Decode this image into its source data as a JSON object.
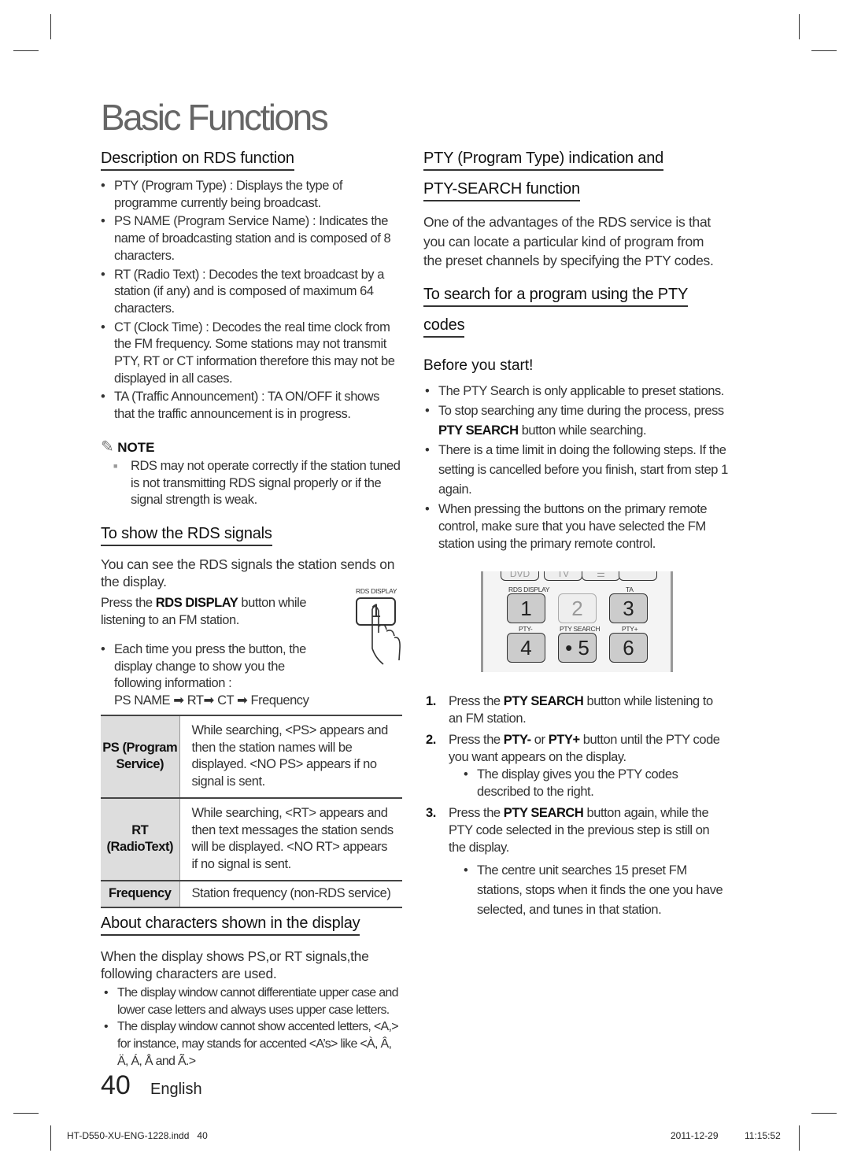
{
  "page": {
    "title": "Basic Functions",
    "page_number": "40",
    "language": "English"
  },
  "left": {
    "desc_heading": "Description on RDS function",
    "desc_items": [
      "PTY (Program Type) : Displays the type of programme currently being broadcast.",
      "PS NAME (Program Service Name) : Indicates the name of broadcasting station and is composed of 8 characters.",
      "RT (Radio Text) : Decodes the text broadcast by a station (if any) and is composed of maximum 64 characters.",
      "CT (Clock Time) : Decodes the real time clock from the FM frequency. Some stations may not transmit PTY, RT or CT information therefore this may not be displayed in all cases.",
      "TA (Traffic Announcement) : TA ON/OFF it shows that the traffic announcement is in progress."
    ],
    "note_label": "NOTE",
    "note_text": "RDS may not operate correctly if the station tuned is not transmitting RDS signal properly or if the signal strength is weak.",
    "show_heading": "To show the RDS signals",
    "show_para": "You can see the RDS signals the station sends on the display.",
    "press_pre": "Press the ",
    "press_bold": "RDS DISPLAY",
    "press_post": " button while listening to an FM station.",
    "illus_label": "RDS DISPLAY",
    "illus_key": "1",
    "each_time": "Each time you press the button, the display change to show you the following information :",
    "sequence": "PS NAME ➡ RT➡ CT ➡ Frequency",
    "table": [
      {
        "key": "PS (Program Service)",
        "value": "While searching, <PS> appears and then the station names will be displayed. <NO PS> appears if no signal is sent."
      },
      {
        "key": "RT (RadioText)",
        "value": "While searching, <RT> appears and then text messages the station sends will be displayed. <NO RT> appears if no signal is sent."
      },
      {
        "key": "Frequency",
        "value": "Station frequency (non-RDS service)"
      }
    ],
    "chars_heading": "About characters shown in the display",
    "chars_para": "When the display shows PS,or RT signals,the following characters are used.",
    "chars_items": [
      "The display window cannot differentiate upper case and lower case letters and always uses upper case letters.",
      "The display window cannot show accented letters, <A,> for instance, may stands for accented <A’s> like <À, Â, Ä, Á, Å and Ã.>"
    ]
  },
  "right": {
    "pty_heading_1": "PTY (Program Type) indication and",
    "pty_heading_2": "PTY-SEARCH function",
    "pty_para": "One of the advantages of the RDS service is that you can locate a particular kind of program from the preset channels by specifying the PTY codes.",
    "search_heading_1": "To search for a program using the PTY",
    "search_heading_2": "codes",
    "before_heading": "Before you start!",
    "b1": "The PTY Search is only applicable to preset stations.",
    "b2_pre": "To stop searching any time during the process, press ",
    "b2_bold": "PTY SEARCH",
    "b2_post": " button while searching.",
    "b3": "There is a time limit in doing the following steps. If the setting is cancelled before you finish, start from step 1 again.",
    "b4": "When pressing the buttons on the primary remote control, make sure that you have selected the FM station using the primary remote control.",
    "remote": {
      "top_keys": [
        "DVD",
        "TV",
        "☰",
        ""
      ],
      "labels": [
        "RDS DISPLAY",
        "TA",
        "PTY-",
        "PTY SEARCH",
        "PTY+"
      ],
      "keys": [
        "1",
        "2",
        "3",
        "4",
        "• 5",
        "6"
      ]
    },
    "steps": [
      {
        "n": "1.",
        "pre": "Press the ",
        "bold": "PTY SEARCH",
        "post": " button while listening to an FM station."
      },
      {
        "n": "2.",
        "pre": "Press the ",
        "bold": "PTY-",
        "mid": " or ",
        "bold2": "PTY+",
        "post": " button until the PTY code you want appears on the display.",
        "sub": "The display gives you the PTY codes described to the right."
      },
      {
        "n": "3.",
        "pre": "Press the ",
        "bold": "PTY SEARCH",
        "post": " button again, while the PTY code selected in the previous step is still on the display.",
        "sub": "The centre unit searches 15 preset FM stations, stops when it finds the one you have selected, and tunes in that station."
      }
    ]
  },
  "footer": {
    "file": "HT-D550-XU-ENG-1228.indd   40",
    "date": "2011-12-29",
    "time": "11:15:52"
  }
}
